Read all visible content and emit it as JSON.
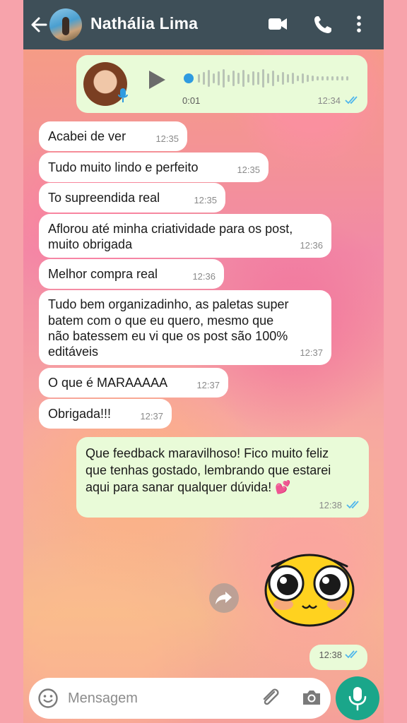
{
  "header": {
    "contact_name": "Nathália Lima"
  },
  "voice_message": {
    "duration": "0:01",
    "time": "12:34",
    "status": "read"
  },
  "messages": [
    {
      "text": "Acabei de ver",
      "time": "12:35"
    },
    {
      "text": "Tudo muito lindo e perfeito",
      "time": "12:35"
    },
    {
      "text": "To supreendida real",
      "time": "12:35"
    },
    {
      "lines": [
        "Aflorou até minha criatividade para os post,",
        "muito obrigada"
      ],
      "time": "12:36"
    },
    {
      "text": "Melhor compra real",
      "time": "12:36"
    },
    {
      "lines": [
        "Tudo bem organizadinho, as paletas super",
        "batem com o que eu quero, mesmo que",
        "não batessem eu vi que os post são 100%",
        "editáveis"
      ],
      "time": "12:37"
    },
    {
      "text": "O que é MARAAAAA",
      "time": "12:37"
    },
    {
      "text": "Obrigada!!!",
      "time": "12:37"
    }
  ],
  "reply": {
    "lines": [
      "Que feedback maravilhoso! Fico muito feliz",
      "que tenhas gostado, lembrando que estarei",
      "aqui para sanar qualquer dúvida! 💕"
    ],
    "time": "12:38"
  },
  "sticker_message": {
    "time": "12:38"
  },
  "input": {
    "placeholder": "Mensagem"
  },
  "colors": {
    "header": "#3e4f58",
    "outgoing_bubble": "#e9fbd8",
    "incoming_bubble": "#ffffff",
    "read_ticks": "#4fb6ec",
    "mic_button": "#1aa68a"
  }
}
